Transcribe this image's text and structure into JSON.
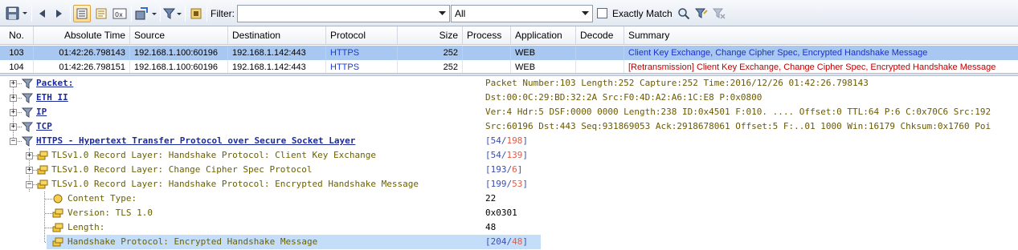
{
  "toolbar": {
    "filter_label": "Filter:",
    "filter_value": "",
    "scope_value": "All",
    "exactly_match_label": "Exactly Match",
    "exactly_match_checked": false
  },
  "packet_list": {
    "columns": [
      "No.",
      "Absolute Time",
      "Source",
      "Destination",
      "Protocol",
      "Size",
      "Process",
      "Application",
      "Decode",
      "Summary"
    ],
    "rows": [
      {
        "no": "103",
        "time": "01:42:26.798143",
        "source": "192.168.1.100:60196",
        "destination": "192.168.1.142:443",
        "protocol": "HTTPS",
        "size": "252",
        "process": "",
        "application": "WEB",
        "decode": "",
        "summary": "Client Key Exchange, Change Cipher Spec, Encrypted Handshake Message",
        "selected": true
      },
      {
        "no": "104",
        "time": "01:42:26.798151",
        "source": "192.168.1.100:60196",
        "destination": "192.168.1.142:443",
        "protocol": "HTTPS",
        "size": "252",
        "process": "",
        "application": "WEB",
        "decode": "",
        "summary": "[Retransmission] Client Key Exchange, Change Cipher Spec, Encrypted Handshake Message",
        "selected": false
      }
    ]
  },
  "detail_tree": {
    "packet": {
      "label": "Packet:",
      "value": "Packet Number:103 Length:252 Capture:252 Time:2016/12/26 01:42:26.798143"
    },
    "eth": {
      "label": "ETH II",
      "value": "Dst:00:0C:29:BD:32:2A Src:F0:4D:A2:A6:1C:E8 P:0x0800"
    },
    "ip": {
      "label": "IP",
      "value": "Ver:4 Hdr:5 DSF:0000 0000 Length:238 ID:0x4501 F:010. .... Offset:0 TTL:64 P:6 C:0x70C6 Src:192"
    },
    "tcp": {
      "label": "TCP",
      "value": "Src:60196 Dst:443 Seq:931869053 Ack:2918678061 Offset:5 F:..01 1000 Win:16179 Chksum:0x1760 Poi"
    },
    "https": {
      "label": "HTTPS - Hypertext Transfer Protocol over Secure Socket Layer",
      "offset": "54",
      "length": "198"
    },
    "tls1": {
      "label": "TLSv1.0 Record Layer: Handshake Protocol: Client Key Exchange",
      "offset": "54",
      "length": "139"
    },
    "tls2": {
      "label": "TLSv1.0 Record Layer: Change Cipher Spec Protocol",
      "offset": "193",
      "length": "6"
    },
    "tls3": {
      "label": "TLSv1.0 Record Layer: Handshake Protocol: Encrypted Handshake Message",
      "offset": "199",
      "length": "53"
    },
    "content_type": {
      "label": "Content Type:",
      "value": "22"
    },
    "version": {
      "label": "Version: TLS 1.0",
      "value": "0x0301"
    },
    "length": {
      "label": "Length:",
      "value": "48"
    },
    "handshake": {
      "label": "Handshake Protocol: Encrypted Handshake Message",
      "offset": "204",
      "length": "48"
    }
  },
  "colors": {
    "selected_row": "#a9c8f1",
    "protocol_link": "#1c2b9c",
    "retransmission_text": "#c00000",
    "highlight_row": "#c4defa"
  }
}
